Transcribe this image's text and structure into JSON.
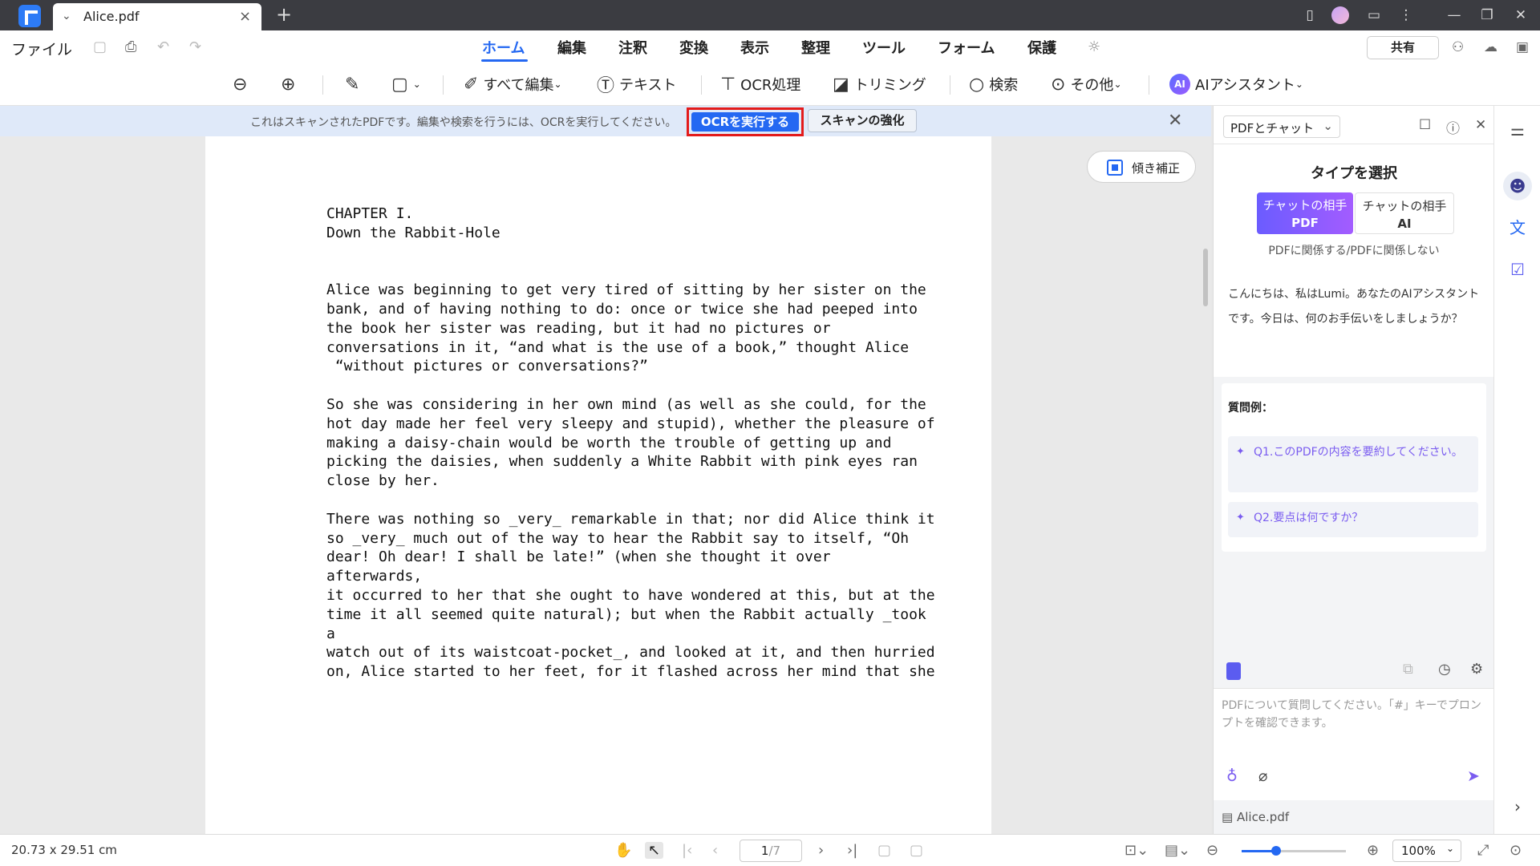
{
  "titlebar": {
    "tab_title": "Alice.pdf",
    "tab_close": "×",
    "new_tab": "+"
  },
  "menubar": {
    "file": "ファイル",
    "tabs": [
      "ホーム",
      "編集",
      "注釈",
      "変換",
      "表示",
      "整理",
      "ツール",
      "フォーム",
      "保護"
    ],
    "active_tab": "ホーム",
    "share": "共有"
  },
  "toolbar": {
    "edit_all": "すべて編集",
    "text": "テキスト",
    "ocr": "OCR処理",
    "crop": "トリミング",
    "search": "検索",
    "more": "その他",
    "ai_badge": "AI",
    "ai_assistant": "AIアシスタント"
  },
  "notice": {
    "message": "これはスキャンされたPDFです。編集や検索を行うには、OCRを実行してください。",
    "run_ocr": "OCRを実行する",
    "enhance_scan": "スキャンの強化"
  },
  "document": {
    "deskew": "傾き補正",
    "lines": [
      "CHAPTER I.",
      "Down the Rabbit-Hole",
      "",
      "",
      "Alice was beginning to get very tired of sitting by her sister on the",
      "bank, and of having nothing to do: once or twice she had peeped into",
      "the book her sister was reading, but it had no pictures or",
      "conversations in it, “and what is the use of a book,” thought Alice",
      " “without pictures or conversations?”",
      "",
      "So she was considering in her own mind (as well as she could, for the",
      "hot day made her feel very sleepy and stupid), whether the pleasure of",
      "making a daisy-chain would be worth the trouble of getting up and",
      "picking the daisies, when suddenly a White Rabbit with pink eyes ran",
      "close by her.",
      "",
      "There was nothing so _very_ remarkable in that; nor did Alice think it",
      "so _very_ much out of the way to hear the Rabbit say to itself, “Oh",
      "dear! Oh dear! I shall be late!” (when she thought it over",
      "afterwards,",
      "it occurred to her that she ought to have wondered at this, but at the",
      "time it all seemed quite natural); but when the Rabbit actually _took",
      "a",
      "watch out of its waistcoat-pocket_, and looked at it, and then hurried",
      "on, Alice started to her feet, for it flashed across her mind that she"
    ]
  },
  "panel": {
    "mode": "PDFとチャット",
    "title": "タイプを選択",
    "type_pdf_line1": "チャットの相手",
    "type_pdf_line2": "PDF",
    "type_ai_line1": "チャットの相手",
    "type_ai_line2": "AI",
    "type_sub": "PDFに関係する/PDFに関係しない",
    "greeting": "こんにちは、私はLumi。あなたのAIアシスタントです。今日は、何のお手伝いをしましょうか？",
    "examples_head": "質問例：",
    "q1": "Q1.このPDFの内容を要約してください。",
    "q2": "Q2.要点は何ですか？",
    "input_placeholder": "PDFについて質問してください。「#」キーでプロンプトを確認できます。",
    "file": "Alice.pdf"
  },
  "statusbar": {
    "page_size": "20.73 x 29.51 cm",
    "page_current": "1",
    "page_total": "/7",
    "zoom": "100%",
    "zoom_level": 0.33
  },
  "colors": {
    "accent": "#2468f2",
    "highlight_border": "#e31b1b",
    "ai_purple": "#7a5cf0"
  }
}
